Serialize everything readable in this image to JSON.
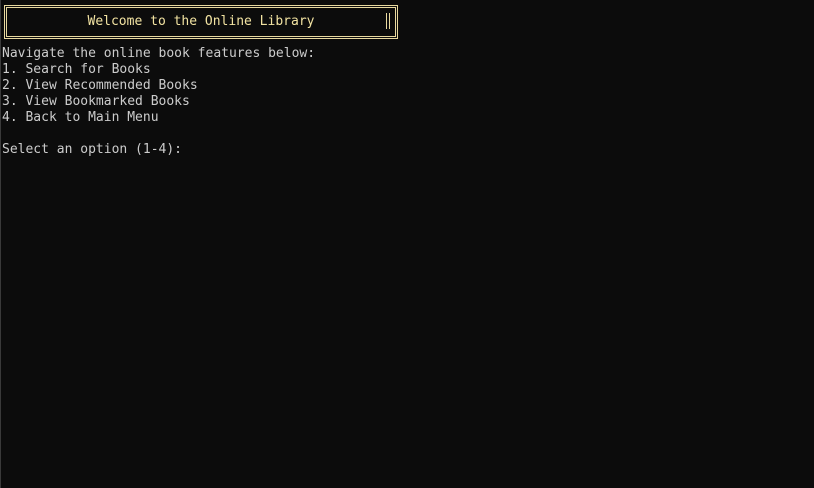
{
  "banner": {
    "title": "Welcome to the Online Library"
  },
  "intro": "Navigate the online book features below:",
  "menu": [
    {
      "label": "1. Search for Books"
    },
    {
      "label": "2. View Recommended Books"
    },
    {
      "label": "3. View Bookmarked Books"
    },
    {
      "label": "4. Back to Main Menu"
    }
  ],
  "prompt": "Select an option (1-4):",
  "colors": {
    "background": "#0c0c0c",
    "text": "#cccccc",
    "banner_accent": "#f2e3a2"
  }
}
